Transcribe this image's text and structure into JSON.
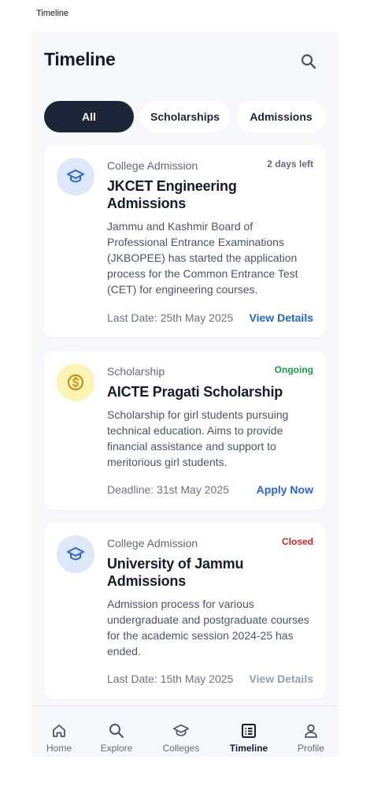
{
  "window": {
    "title": "Timeline"
  },
  "header": {
    "title": "Timeline"
  },
  "tabs": [
    {
      "label": "All",
      "active": true
    },
    {
      "label": "Scholarships",
      "active": false
    },
    {
      "label": "Admissions",
      "active": false
    }
  ],
  "cards": [
    {
      "category": "College Admission",
      "badge": "2 days left",
      "title": "JKCET Engineering Admissions",
      "description": "Jammu and Kashmir Board of Professional Entrance Examinations (JKBOPEE) has started the application process for the Common Entrance Test (CET) for engineering courses.",
      "date": "Last Date: 25th May 2025",
      "action": "View Details",
      "icon": "graduation-cap-icon"
    },
    {
      "category": "Scholarship",
      "badge": "Ongoing",
      "title": "AICTE Pragati Scholarship",
      "description": "Scholarship for girl students pursuing technical education. Aims to provide financial assistance and support to meritorious girl students.",
      "date": "Deadline: 31st May 2025",
      "action": "Apply Now",
      "icon": "dollar-coin-icon"
    },
    {
      "category": "College Admission",
      "badge": "Closed",
      "title": "University of Jammu Admissions",
      "description": "Admission process for various undergraduate and postgraduate courses for the academic session 2024-25 has ended.",
      "date": "Last Date: 15th May 2025",
      "action": "View Details",
      "icon": "graduation-cap-icon"
    }
  ],
  "nav": [
    {
      "label": "Home",
      "icon": "home-icon"
    },
    {
      "label": "Explore",
      "icon": "search-icon"
    },
    {
      "label": "Colleges",
      "icon": "graduation-cap-icon"
    },
    {
      "label": "Timeline",
      "icon": "list-icon",
      "active": true
    },
    {
      "label": "Profile",
      "icon": "user-icon"
    }
  ],
  "colors": {
    "primary": "#1c2638",
    "link": "#2563eb",
    "badge_neutral": "#5f6b7d",
    "badge_ongoing": "#16a34a",
    "badge_closed": "#dc2626",
    "disabled": "#94a0b2"
  }
}
